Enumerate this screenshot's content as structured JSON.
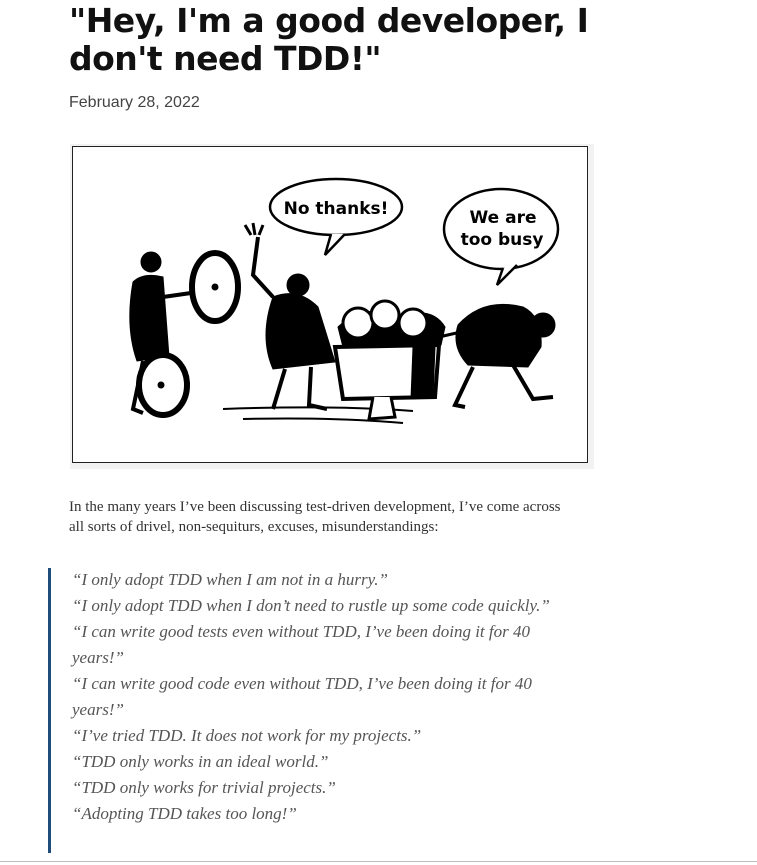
{
  "article": {
    "title": "\"Hey, I'm a good developer, I don't need TDD!\"",
    "date": "February 28, 2022",
    "cartoon": {
      "bubble_left": "No thanks!",
      "bubble_right_line1": "We are",
      "bubble_right_line2": "too busy"
    },
    "intro": "In the many years I’ve been discussing test-driven development, I’ve come across all sorts of drivel, non-sequiturs, excuses, misunderstandings:",
    "quotes": [
      "“I only adopt TDD when I am not in a hurry.”",
      "“I only adopt TDD when I don’t need to rustle up some code quickly.”",
      "“I can write good tests even without TDD, I’ve been doing it for 40 years!”",
      "“I can write good code even without TDD, I’ve been doing it for 40 years!”",
      "“I’ve tried TDD. It does not work for my projects.”",
      "“TDD only works in an ideal world.”",
      "“TDD only works for trivial projects.”",
      "“Adopting TDD takes too long!”"
    ]
  }
}
